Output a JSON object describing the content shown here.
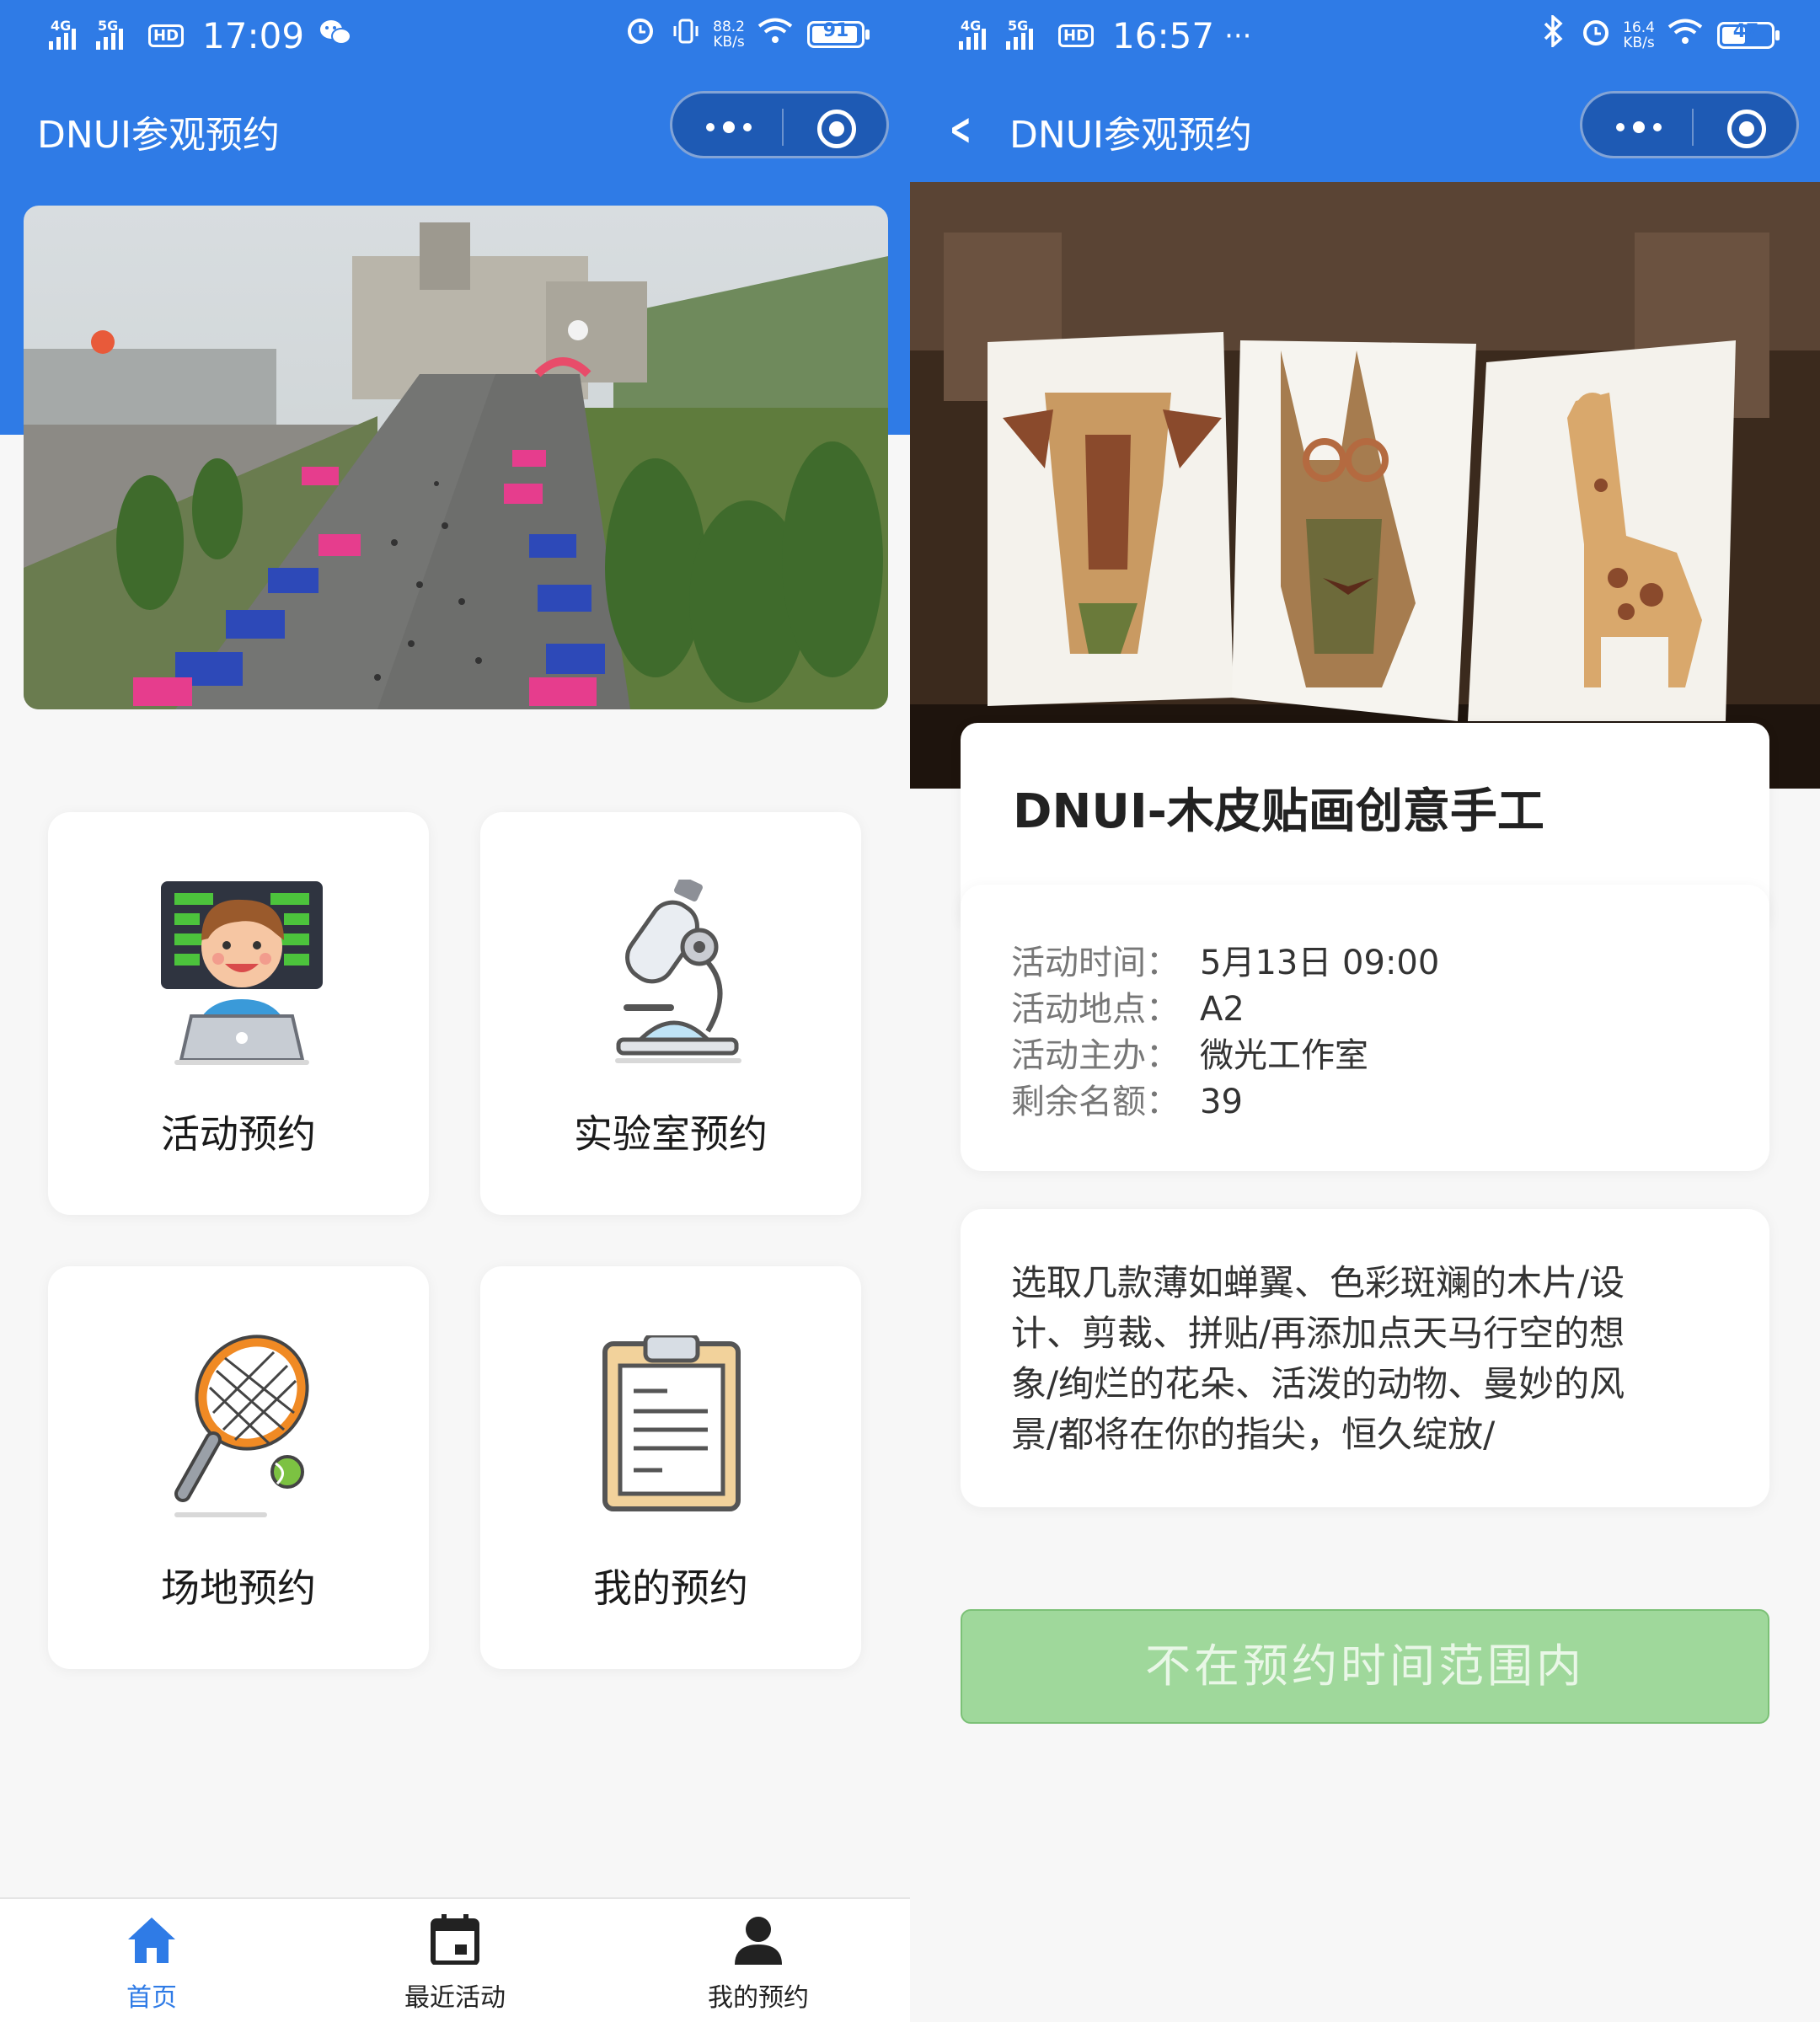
{
  "left": {
    "status_bar": {
      "network1": "4G",
      "network2": "5G",
      "hd": "HD",
      "time": "17:09",
      "speed_value": "88.2",
      "speed_unit": "KB/s",
      "battery": "91"
    },
    "nav": {
      "title": "DNUI参观预约"
    },
    "banner": {
      "icon": "campus-banner-image"
    },
    "menu": [
      {
        "label": "活动预约",
        "icon": "presenter-laptop-icon"
      },
      {
        "label": "实验室预约",
        "icon": "microscope-icon"
      },
      {
        "label": "场地预约",
        "icon": "tennis-racket-icon"
      },
      {
        "label": "我的预约",
        "icon": "clipboard-icon"
      }
    ],
    "tabbar": {
      "items": [
        {
          "label": "首页",
          "icon": "home-icon",
          "active": true
        },
        {
          "label": "最近活动",
          "icon": "calendar-icon",
          "active": false
        },
        {
          "label": "我的预约",
          "icon": "user-icon",
          "active": false
        }
      ]
    }
  },
  "right": {
    "status_bar": {
      "network1": "4G",
      "network2": "5G",
      "hd": "HD",
      "time": "16:57",
      "more": "···",
      "speed_value": "16.4",
      "speed_unit": "KB/s",
      "battery": "47"
    },
    "nav": {
      "title": "DNUI参观预约"
    },
    "hero": {
      "icon": "wood-veneer-art-image"
    },
    "activity": {
      "title": "DNUI-木皮贴画创意手工",
      "info": [
        {
          "key": "活动时间：",
          "value": "5月13日 09:00"
        },
        {
          "key": "活动地点：",
          "value": "A2"
        },
        {
          "key": "活动主办：",
          "value": "微光工作室"
        },
        {
          "key": "剩余名额：",
          "value": "39"
        }
      ],
      "description": "选取几款薄如蝉翼、色彩斑斓的木片/设计、剪裁、拼贴/再添加点天马行空的想象/绚烂的花朵、活泼的动物、曼妙的风景/都将在你的指尖，恒久绽放/",
      "button_label": "不在预约时间范围内"
    }
  },
  "colors": {
    "primary": "#2f7be6",
    "disabled_button": "#9fd89b",
    "background": "#f7f7f7"
  }
}
